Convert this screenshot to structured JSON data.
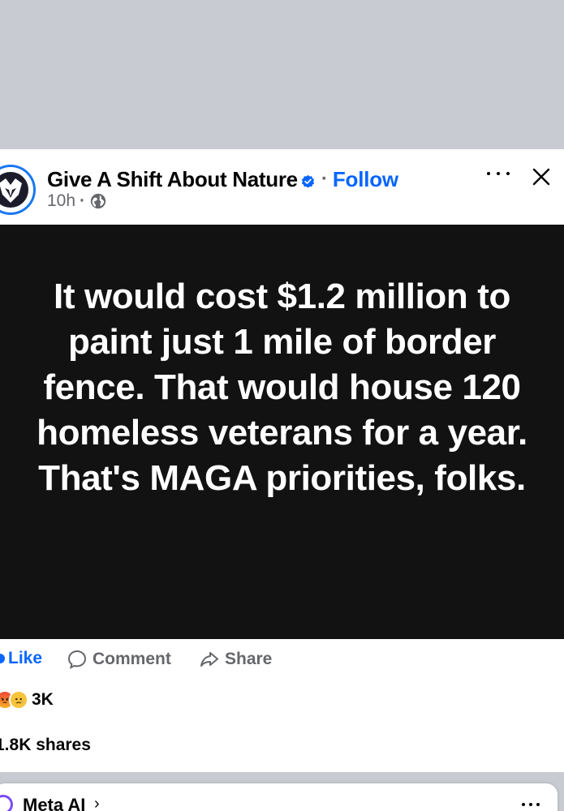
{
  "post": {
    "page_name": "Give A Shift About Nature",
    "dot_separator": "·",
    "follow_label": "Follow",
    "time": "10h",
    "time_separator": "·",
    "image_text": "It would cost $1.2 million to paint just 1 mile of border fence. That would house 120 homeless veterans for a year. That's MAGA priorities, folks."
  },
  "actions": {
    "like_label": "Like",
    "comment_label": "Comment",
    "share_label": "Share"
  },
  "stats": {
    "reaction_count": "3K",
    "shares_text": "1.8K shares"
  },
  "meta_ai": {
    "label": "Meta AI",
    "chevron": "›"
  },
  "colors": {
    "accent_blue": "#0866ff",
    "background_gray": "#c8cbd1",
    "image_background": "#121212",
    "text_secondary": "#65676b"
  },
  "icons": [
    "verified-badge-icon",
    "globe-icon",
    "more-options-icon",
    "close-icon",
    "like-icon",
    "comment-icon",
    "share-icon",
    "angry-reaction-icon",
    "sad-reaction-icon",
    "meta-ai-ring-icon"
  ]
}
